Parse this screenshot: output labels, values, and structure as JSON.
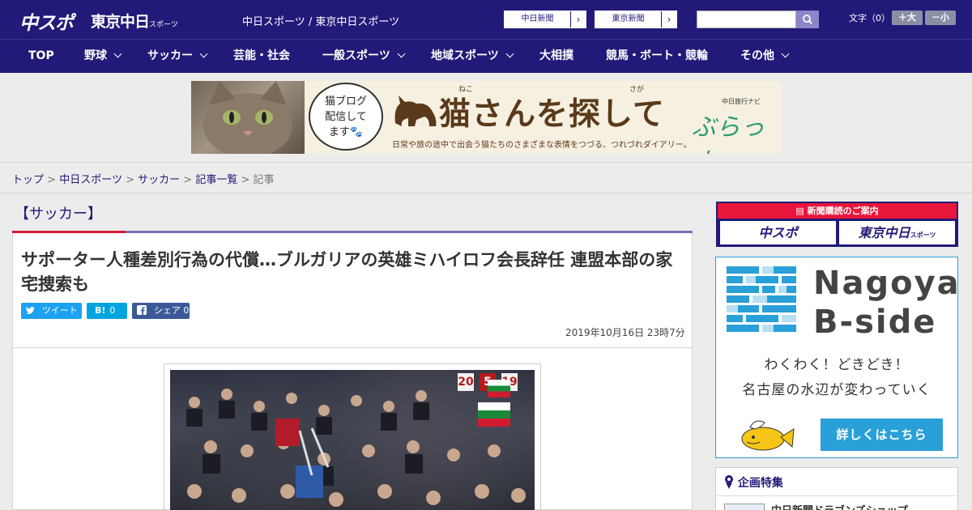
{
  "header": {
    "logo_chuspo": "中スポ",
    "logo_tokyo": "東京中日",
    "logo_tokyo_suffix": "スポーツ",
    "site_name": "中日スポーツ / 東京中日スポーツ",
    "paper_links": [
      {
        "label": "中日新聞",
        "arrow": "›"
      },
      {
        "label": "東京新聞",
        "arrow": "›"
      }
    ],
    "search": {
      "placeholder": "",
      "icon": "search-icon"
    },
    "font_size": {
      "label": "文字（0）",
      "larger": "＋大",
      "smaller": "－小"
    }
  },
  "nav": {
    "items": [
      {
        "label": "TOP",
        "has_dropdown": false
      },
      {
        "label": "野球",
        "has_dropdown": true
      },
      {
        "label": "サッカー",
        "has_dropdown": true
      },
      {
        "label": "芸能・社会",
        "has_dropdown": false
      },
      {
        "label": "一般スポーツ",
        "has_dropdown": true
      },
      {
        "label": "地域スポーツ",
        "has_dropdown": true
      },
      {
        "label": "大相撲",
        "has_dropdown": false
      },
      {
        "label": "競馬・ボート・競輪",
        "has_dropdown": false
      },
      {
        "label": "その他",
        "has_dropdown": true
      }
    ]
  },
  "ad_banner": {
    "bubble_line1": "猫ブログ",
    "bubble_line2": "配信して",
    "bubble_line3": "ます🐾",
    "ruby_neko": "ねこ",
    "ruby_saga": "さが",
    "title": "猫さんを探して",
    "subtitle": "日常や旅の途中で出会う猫たちのさまざまな表情をつづる、つれづれダイアリー。",
    "navi": "中日旅行ナビ",
    "brand": "ぶらっ人"
  },
  "breadcrumb": {
    "items": [
      "トップ",
      "中日スポーツ",
      "サッカー",
      "記事一覧"
    ],
    "current": "記事",
    "separator": ">"
  },
  "article": {
    "category": "【サッカー】",
    "headline": "サポーター人種差別行為の代償…ブルガリアの英雄ミハイロフ会長辞任 連盟本部の家宅捜索も",
    "share": {
      "tweet": "ツイート",
      "hatena_label": "B!",
      "hatena_count": "0",
      "facebook_label": "シェア",
      "facebook_count": "0"
    },
    "date": "2019年10月16日 23時7分",
    "photo_signs": [
      "20",
      "5",
      "19"
    ]
  },
  "sidebar": {
    "subscribe": {
      "header": "新聞購読のご案内",
      "chuspo": "中スポ",
      "tokyo": "東京中日",
      "tokyo_suffix": "スポーツ"
    },
    "bside": {
      "title_line1": "Nagoya",
      "title_line2": "B-side",
      "copy_line1": "わくわく！どきどき！",
      "copy_line2": "名古屋の水辺が変わっていく",
      "button": "詳しくはこちら"
    },
    "special": {
      "header": "企画特集",
      "item": "中日新聞ドラゴンズショップ"
    }
  },
  "colors": {
    "brand_navy": "#221a78",
    "accent_red": "#d21b2f",
    "twitter": "#1da1f2",
    "hatena": "#00a4de",
    "facebook": "#3b5998",
    "bside_blue": "#29a0d8"
  }
}
